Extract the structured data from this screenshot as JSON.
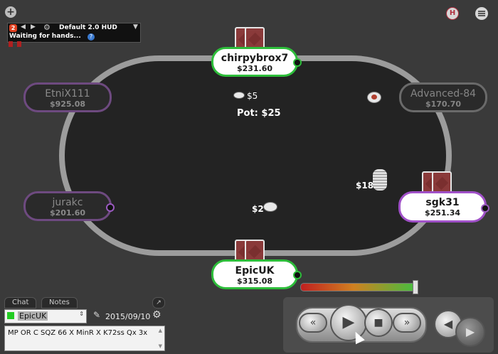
{
  "toolbar": {
    "add_icon": "plus-circle-icon",
    "hud_toggle_icon": "h-icon",
    "menu_icon": "hamburger-icon"
  },
  "hud": {
    "badge": "2",
    "profile": "Default 2.0 HUD",
    "status": "Waiting for hands...",
    "help": "?"
  },
  "seats": {
    "top": {
      "name": "chirpybrox7",
      "stack": "$231.60"
    },
    "left_upper": {
      "name": "EtniX111",
      "stack": "$925.08"
    },
    "right_upper": {
      "name": "Advanced-84",
      "stack": "$170.70"
    },
    "left_lower": {
      "name": "jurakc",
      "stack": "$201.60"
    },
    "right_lower": {
      "name": "sgk31",
      "stack": "$251.34"
    },
    "bottom": {
      "name": "EpicUK",
      "stack": "$315.08"
    }
  },
  "bets": {
    "top": "$5",
    "right": "$18",
    "bottom": "$2"
  },
  "pot": "Pot: $25",
  "panel": {
    "tabs": [
      "Chat",
      "Notes"
    ],
    "player_select": "EpicUK",
    "date": "2015/09/10",
    "note_text": "MP OR C SQZ 66 X MinR X K72ss Qx 3x"
  },
  "colors": {
    "active_seat": "#2dbd3a",
    "turn_seat": "#a050c8",
    "background": "#3a3a3a"
  }
}
